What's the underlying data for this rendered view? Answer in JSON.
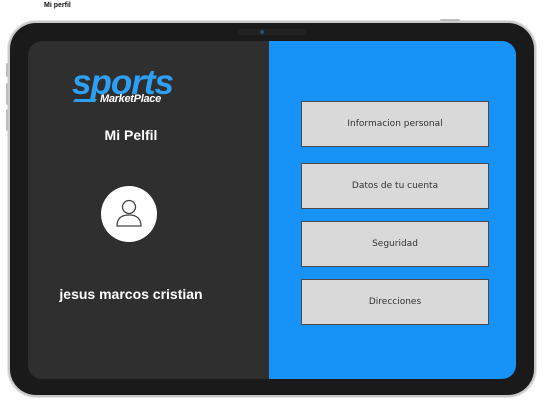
{
  "frame": {
    "label": "Mi perfil"
  },
  "brand": {
    "main": "sports",
    "sub": "MarketPlace",
    "accent_color": "#2da0f5"
  },
  "profile": {
    "title": "Mi Pelfil",
    "user_name": "jesus marcos cristian",
    "avatar_icon": "user-icon"
  },
  "menu": {
    "items": [
      {
        "label": "Informacion personal"
      },
      {
        "label": "Datos de tu cuenta"
      },
      {
        "label": "Seguridad"
      },
      {
        "label": "Direcciones"
      }
    ]
  },
  "colors": {
    "left_panel": "#2f2f2f",
    "right_panel": "#1793f7",
    "button": "#d9d9d9"
  }
}
